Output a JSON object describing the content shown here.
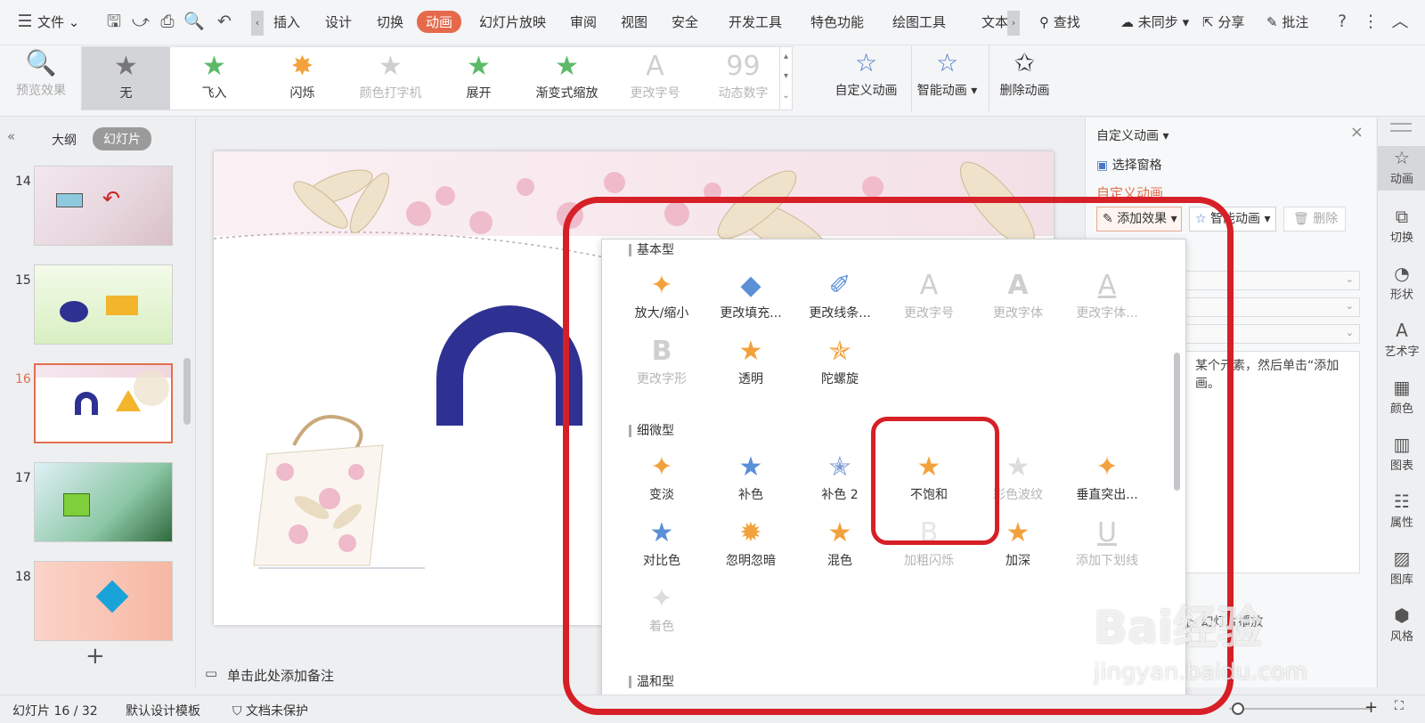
{
  "menubar": {
    "file_label": "文件",
    "tabs": [
      "插入",
      "设计",
      "切换",
      "动画",
      "幻灯片放映",
      "审阅",
      "视图",
      "安全",
      "开发工具",
      "特色功能",
      "绘图工具",
      "文本"
    ],
    "active_tab": "动画",
    "search_label": "查找",
    "sync_label": "未同步",
    "share_label": "分享",
    "comment_label": "批注"
  },
  "ribbon": {
    "preview_label": "预览效果",
    "gallery": [
      {
        "label": "无",
        "state": "selected"
      },
      {
        "label": "飞入",
        "state": "normal"
      },
      {
        "label": "闪烁",
        "state": "normal"
      },
      {
        "label": "颜色打字机",
        "state": "disabled"
      },
      {
        "label": "展开",
        "state": "normal"
      },
      {
        "label": "渐变式缩放",
        "state": "normal"
      },
      {
        "label": "更改字号",
        "state": "disabled"
      },
      {
        "label": "动态数字",
        "state": "disabled"
      }
    ],
    "custom_anim_label": "自定义动画",
    "smart_anim_label": "智能动画",
    "delete_anim_label": "删除动画"
  },
  "left_panel": {
    "tab_outline": "大纲",
    "tab_slides": "幻灯片",
    "thumbnails": [
      "14",
      "15",
      "16",
      "17",
      "18"
    ],
    "selected_thumbnail": "16"
  },
  "notes_placeholder": "单击此处添加备注",
  "right_pane": {
    "title": "自定义动画",
    "select_pane": "选择窗格",
    "section_title": "自定义动画",
    "add_effect": "添加效果",
    "smart_anim": "智能动画",
    "delete": "删除",
    "hint_line1": "某个元素，然后单击“添加",
    "hint_line2": "画。",
    "slideshow_btn": "幻灯片播放"
  },
  "right_strip": [
    "动画",
    "切换",
    "形状",
    "艺术字",
    "颜色",
    "图表",
    "属性",
    "图库",
    "风格"
  ],
  "dropdown": {
    "sections": [
      {
        "title": "基本型",
        "items": [
          {
            "label": "放大/缩小",
            "state": "normal"
          },
          {
            "label": "更改填充...",
            "state": "normal"
          },
          {
            "label": "更改线条...",
            "state": "normal"
          },
          {
            "label": "更改字号",
            "state": "disabled"
          },
          {
            "label": "更改字体",
            "state": "disabled"
          },
          {
            "label": "更改字体...",
            "state": "disabled"
          },
          {
            "label": "更改字形",
            "state": "disabled"
          },
          {
            "label": "透明",
            "state": "normal"
          },
          {
            "label": "陀螺旋",
            "state": "normal"
          }
        ]
      },
      {
        "title": "细微型",
        "items": [
          {
            "label": "变淡",
            "state": "normal"
          },
          {
            "label": "补色",
            "state": "normal"
          },
          {
            "label": "补色 2",
            "state": "normal"
          },
          {
            "label": "不饱和",
            "state": "highlighted"
          },
          {
            "label": "彩色波纹",
            "state": "disabled"
          },
          {
            "label": "垂直突出...",
            "state": "normal"
          },
          {
            "label": "对比色",
            "state": "normal"
          },
          {
            "label": "忽明忽暗",
            "state": "normal"
          },
          {
            "label": "混色",
            "state": "normal"
          },
          {
            "label": "加粗闪烁",
            "state": "disabled"
          },
          {
            "label": "加深",
            "state": "normal"
          },
          {
            "label": "添加下划线",
            "state": "disabled"
          },
          {
            "label": "着色",
            "state": "disabled"
          }
        ]
      },
      {
        "title": "温和型",
        "items": []
      }
    ]
  },
  "statusbar": {
    "slide_counter": "幻灯片 16 / 32",
    "template": "默认设计模板",
    "protection": "文档未保护"
  },
  "watermark": {
    "logo": "Bai经验",
    "url": "jingyan.baidu.com"
  },
  "colors": {
    "accent": "#e56a4c",
    "highlight_red": "#d61f26",
    "star_orange": "#f2a23c",
    "star_blue": "#5b8fd6",
    "shape_navy": "#2e3192"
  }
}
